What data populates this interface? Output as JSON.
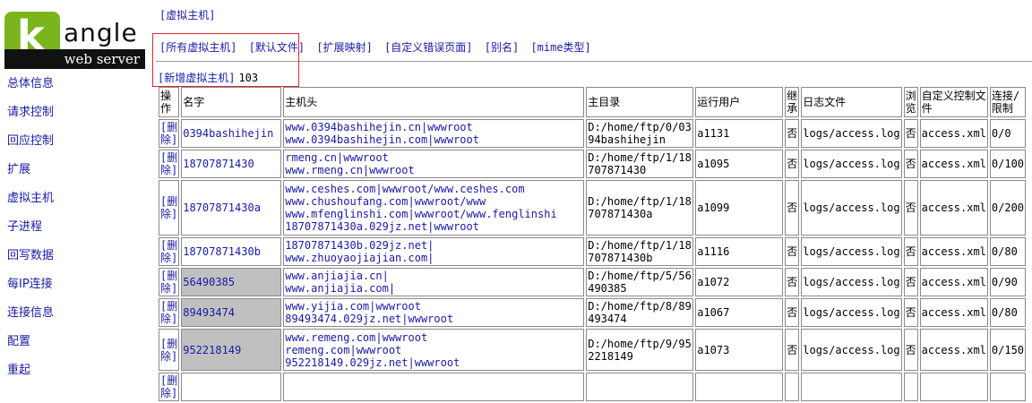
{
  "logo": {
    "letter": "k",
    "word": "angle",
    "sub": "web server"
  },
  "nav": {
    "items": [
      "总体信息",
      "请求控制",
      "回应控制",
      "扩展",
      "虚拟主机",
      "子进程",
      "回写数据",
      "每IP连接",
      "连接信息",
      "配置",
      "重起"
    ]
  },
  "breadcrumb": "[虚拟主机]",
  "tabs": [
    "[所有虚拟主机]",
    "[默认文件]",
    "[扩展映射]",
    "[自定义错误页面]",
    "[别名]",
    "[mime类型]"
  ],
  "add_host": {
    "label": "[新增虚拟主机]",
    "count": "103"
  },
  "table": {
    "headers": [
      "操作",
      "名字",
      "主机头",
      "主目录",
      "运行用户",
      "继承",
      "日志文件",
      "浏览",
      "自定义控制文件",
      "连接/限制"
    ],
    "rows": [
      {
        "action": "[删除]",
        "name": "0394bashihejin",
        "hosts": [
          "www.0394bashihejin.cn|wwwroot",
          "www.0394bashihejin.com|wwwroot"
        ],
        "dir": "D:/home/ftp/0/0394bashihejin",
        "user": "a1131",
        "inherit": "否",
        "log": "logs/access.log",
        "browse": "否",
        "ctrl": "access.xml",
        "conn": "0/0",
        "grey": false
      },
      {
        "action": "[删除]",
        "name": "18707871430",
        "hosts": [
          "rmeng.cn|wwwroot",
          "www.rmeng.cn|wwwroot"
        ],
        "dir": "D:/home/ftp/1/18707871430",
        "user": "a1095",
        "inherit": "否",
        "log": "logs/access.log",
        "browse": "否",
        "ctrl": "access.xml",
        "conn": "0/100",
        "grey": false
      },
      {
        "action": "[删除]",
        "name": "18707871430a",
        "hosts": [
          "www.ceshes.com|wwwroot/www.ceshes.com",
          "www.chushoufang.com|wwwroot/www",
          "www.mfenglinshi.com|wwwroot/www.fenglinshi",
          "18707871430a.029jz.net|wwwroot"
        ],
        "dir": "D:/home/ftp/1/18707871430a",
        "user": "a1099",
        "inherit": "否",
        "log": "logs/access.log",
        "browse": "否",
        "ctrl": "access.xml",
        "conn": "0/200",
        "grey": false
      },
      {
        "action": "[删除]",
        "name": "18707871430b",
        "hosts": [
          "18707871430b.029jz.net|",
          "www.zhuoyaojiajian.com|"
        ],
        "dir": "D:/home/ftp/1/18707871430b",
        "user": "a1116",
        "inherit": "否",
        "log": "logs/access.log",
        "browse": "否",
        "ctrl": "access.xml",
        "conn": "0/80",
        "grey": false
      },
      {
        "action": "[删除]",
        "name": "56490385",
        "hosts": [
          "www.anjiajia.cn|",
          "www.anjiajia.com|"
        ],
        "dir": "D:/home/ftp/5/56490385",
        "user": "a1072",
        "inherit": "否",
        "log": "logs/access.log",
        "browse": "否",
        "ctrl": "access.xml",
        "conn": "0/90",
        "grey": true
      },
      {
        "action": "[删除]",
        "name": "89493474",
        "hosts": [
          "www.yijia.com|wwwroot",
          "89493474.029jz.net|wwwroot"
        ],
        "dir": "D:/home/ftp/8/89493474",
        "user": "a1067",
        "inherit": "否",
        "log": "logs/access.log",
        "browse": "否",
        "ctrl": "access.xml",
        "conn": "0/80",
        "grey": true
      },
      {
        "action": "[删除]",
        "name": "952218149",
        "hosts": [
          "www.remeng.com|wwwroot",
          "remeng.com|wwwroot",
          "952218149.029jz.net|wwwroot"
        ],
        "dir": "D:/home/ftp/9/952218149",
        "user": "a1073",
        "inherit": "否",
        "log": "logs/access.log",
        "browse": "否",
        "ctrl": "access.xml",
        "conn": "0/150",
        "grey": true
      },
      {
        "action": "[删除]",
        "name": "",
        "hosts": [
          ""
        ],
        "dir": "",
        "user": "",
        "inherit": "",
        "log": "",
        "browse": "",
        "ctrl": "",
        "conn": "",
        "grey": false
      }
    ]
  },
  "colors": {
    "link": "#1a1aa6",
    "logo_green": "#7ab51d",
    "highlight_box": "#e0262d",
    "grey_cell": "#c0c0c0"
  }
}
